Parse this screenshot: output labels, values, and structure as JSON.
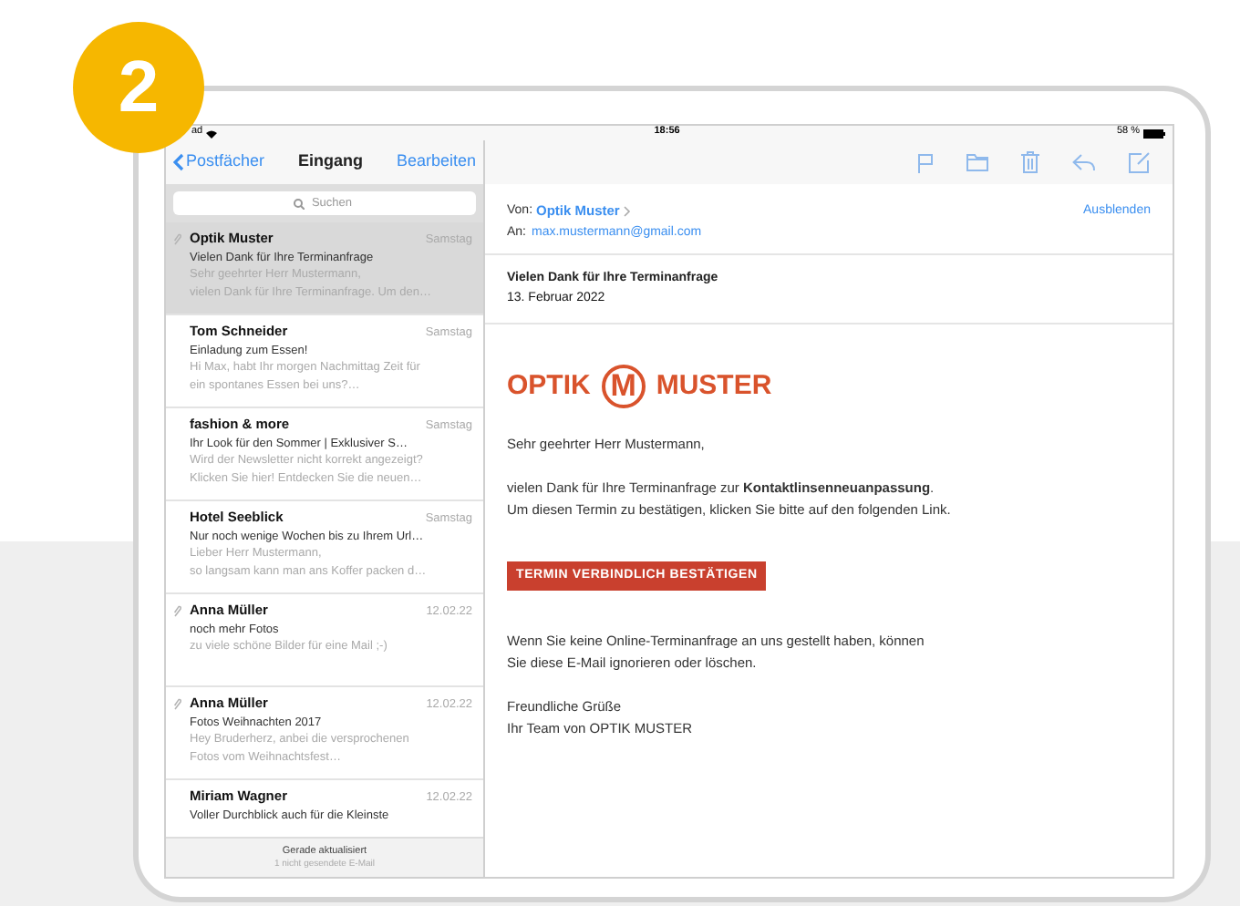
{
  "badge": "2",
  "status_bar": {
    "device": "ad",
    "time": "18:56",
    "battery": "58 %"
  },
  "mailbox": {
    "back": "Postfächer",
    "title": "Eingang",
    "edit": "Bearbeiten",
    "search": {
      "placeholder": "Suchen"
    }
  },
  "messages": [
    {
      "sender": "Optik Muster",
      "date": "Samstag",
      "subject": "Vielen Dank für Ihre Terminanfrage",
      "preview": [
        "Sehr geehrter Herr Mustermann,",
        "vielen Dank für Ihre Terminanfrage. Um den…"
      ],
      "attachment": true,
      "selected": true
    },
    {
      "sender": "Tom Schneider",
      "date": "Samstag",
      "subject": "Einladung zum Essen!",
      "preview": [
        "Hi Max, habt Ihr morgen Nachmittag Zeit für",
        "ein spontanes Essen bei uns?…"
      ],
      "attachment": false,
      "selected": false
    },
    {
      "sender": "fashion & more",
      "date": "Samstag",
      "subject": "Ihr Look für den Sommer | Exklusiver S…",
      "preview": [
        "Wird der Newsletter nicht korrekt angezeigt?",
        "Klicken Sie hier! Entdecken Sie die neuen…"
      ],
      "attachment": false,
      "selected": false
    },
    {
      "sender": "Hotel Seeblick",
      "date": "Samstag",
      "subject": "Nur noch wenige Wochen bis zu Ihrem Url…",
      "preview": [
        "Lieber Herr Mustermann,",
        "so langsam kann man ans Koffer packen d…"
      ],
      "attachment": false,
      "selected": false
    },
    {
      "sender": "Anna Müller",
      "date": "12.02.22",
      "subject": "noch mehr Fotos",
      "preview": [
        "zu viele schöne Bilder für eine Mail ;-)"
      ],
      "attachment": true,
      "selected": false
    },
    {
      "sender": "Anna Müller",
      "date": "12.02.22",
      "subject": "Fotos Weihnachten 2017",
      "preview": [
        "Hey Bruderherz, anbei die versprochenen",
        "Fotos vom Weihnachtsfest…"
      ],
      "attachment": true,
      "selected": false
    },
    {
      "sender": "Miriam Wagner",
      "date": "12.02.22",
      "subject": "Voller Durchblick auch für die Kleinste",
      "attachment": false,
      "selected": false
    }
  ],
  "list_footer": {
    "status": "Gerade aktualisiert",
    "note": "1 nicht gesendete E-Mail"
  },
  "message": {
    "from_label": "Von:",
    "from": "Optik Muster",
    "hide": "Ausblenden",
    "to_label": "An:",
    "to": "max.mustermann@gmail.com",
    "subject": "Vielen Dank für Ihre Terminanfrage",
    "date": "13. Februar 2022",
    "logo": {
      "left": "OPTIK",
      "mark": "M",
      "right": "MUSTER"
    },
    "greeting": "Sehr geehrter Herr Mustermann,",
    "intro": [
      "vielen Dank für Ihre Terminanfrage zur **Kontaktlinsenneuanpassung**.",
      "Um diesen Termin zu bestätigen, klicken Sie bitte auf den folgenden Link."
    ],
    "button": "TERMIN VERBINDLICH BESTÄTIGEN",
    "notice": [
      "Wenn Sie keine Online-Terminanfrage an uns gestellt haben, können",
      "Sie diese E-Mail ignorieren oder löschen."
    ],
    "closing": [
      "Freundliche Grüße",
      "Ihr Team von OPTIK MUSTER"
    ]
  }
}
